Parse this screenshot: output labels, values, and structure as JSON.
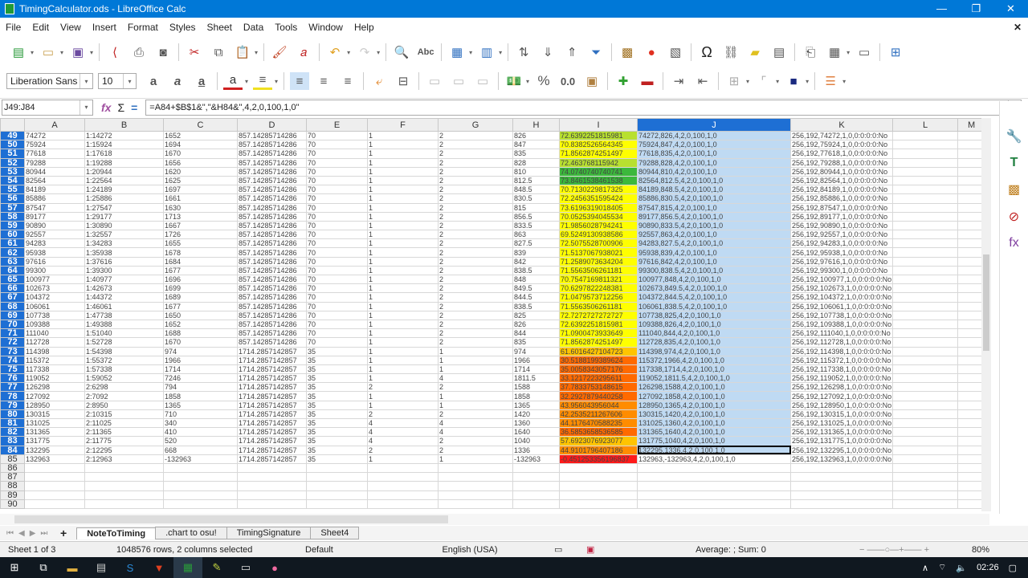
{
  "window": {
    "title": "TimingCalculator.ods - LibreOffice Calc",
    "minimize": "—",
    "maximize": "❐",
    "close": "✕"
  },
  "menu": [
    "File",
    "Edit",
    "View",
    "Insert",
    "Format",
    "Styles",
    "Sheet",
    "Data",
    "Tools",
    "Window",
    "Help"
  ],
  "menu_close": "✕",
  "toolbar": {
    "font_name": "Liberation Sans",
    "font_size": "10"
  },
  "formula": {
    "name_box": "J49:J84",
    "content": "=A84+$B$1&\",\"&H84&\",4,2,0,100,1,0\""
  },
  "columns": [
    "A",
    "B",
    "C",
    "D",
    "E",
    "F",
    "G",
    "H",
    "I",
    "J",
    "K",
    "L",
    "M"
  ],
  "colors": {
    "selection": "#1e6fd4",
    "yellow": "#ffff00",
    "light_green": "#b8e030",
    "green": "#3cb83c",
    "orange": "#ff8c00",
    "dark_orange": "#ff6a00",
    "red": "#ff1a1a",
    "amber": "#ffc400"
  },
  "rows": [
    {
      "n": "49",
      "A": "74272",
      "B": "1:14272",
      "C": "1652",
      "D": "857.14285714286",
      "E": "70",
      "F": "1",
      "G": "2",
      "H": "826",
      "I": "72.6392251815981",
      "J": "74272,826,4,2,0,100,1,0",
      "K": "256,192,74272,1,0,0:0:0:0:No",
      "c": "light_green"
    },
    {
      "n": "50",
      "A": "75924",
      "B": "1:15924",
      "C": "1694",
      "D": "857.14285714286",
      "E": "70",
      "F": "1",
      "G": "2",
      "H": "847",
      "I": "70.8382526564345",
      "J": "75924,847,4,2,0,100,1,0",
      "K": "256,192,75924,1,0,0:0:0:0:No",
      "c": "yellow"
    },
    {
      "n": "51",
      "A": "77618",
      "B": "1:17618",
      "C": "1670",
      "D": "857.14285714286",
      "E": "70",
      "F": "1",
      "G": "2",
      "H": "835",
      "I": "71.8562874251497",
      "J": "77618,835,4,2,0,100,1,0",
      "K": "256,192,77618,1,0,0:0:0:0:No",
      "c": "yellow"
    },
    {
      "n": "52",
      "A": "79288",
      "B": "1:19288",
      "C": "1656",
      "D": "857.14285714286",
      "E": "70",
      "F": "1",
      "G": "2",
      "H": "828",
      "I": "72.463768115942",
      "J": "79288,828,4,2,0,100,1,0",
      "K": "256,192,79288,1,0,0:0:0:0:No",
      "c": "light_green"
    },
    {
      "n": "53",
      "A": "80944",
      "B": "1:20944",
      "C": "1620",
      "D": "857.14285714286",
      "E": "70",
      "F": "1",
      "G": "2",
      "H": "810",
      "I": "74.0740740740741",
      "J": "80944,810,4,2,0,100,1,0",
      "K": "256,192,80944,1,0,0:0:0:0:No",
      "c": "green"
    },
    {
      "n": "54",
      "A": "82564",
      "B": "1:22564",
      "C": "1625",
      "D": "857.14285714286",
      "E": "70",
      "F": "1",
      "G": "2",
      "H": "812.5",
      "I": "73.8461538461538",
      "J": "82564,812.5,4,2,0,100,1,0",
      "K": "256,192,82564,1,0,0:0:0:0:No",
      "c": "green"
    },
    {
      "n": "55",
      "A": "84189",
      "B": "1:24189",
      "C": "1697",
      "D": "857.14285714286",
      "E": "70",
      "F": "1",
      "G": "2",
      "H": "848.5",
      "I": "70.7130229817325",
      "J": "84189,848.5,4,2,0,100,1,0",
      "K": "256,192,84189,1,0,0:0:0:0:No",
      "c": "yellow"
    },
    {
      "n": "56",
      "A": "85886",
      "B": "1:25886",
      "C": "1661",
      "D": "857.14285714286",
      "E": "70",
      "F": "1",
      "G": "2",
      "H": "830.5",
      "I": "72.2456351595424",
      "J": "85886,830.5,4,2,0,100,1,0",
      "K": "256,192,85886,1,0,0:0:0:0:No",
      "c": "yellow"
    },
    {
      "n": "57",
      "A": "87547",
      "B": "1:27547",
      "C": "1630",
      "D": "857.14285714286",
      "E": "70",
      "F": "1",
      "G": "2",
      "H": "815",
      "I": "73.6196319018405",
      "J": "87547,815,4,2,0,100,1,0",
      "K": "256,192,87547,1,0,0:0:0:0:No",
      "c": "yellow"
    },
    {
      "n": "58",
      "A": "89177",
      "B": "1:29177",
      "C": "1713",
      "D": "857.14285714286",
      "E": "70",
      "F": "1",
      "G": "2",
      "H": "856.5",
      "I": "70.0525394045534",
      "J": "89177,856.5,4,2,0,100,1,0",
      "K": "256,192,89177,1,0,0:0:0:0:No",
      "c": "yellow"
    },
    {
      "n": "59",
      "A": "90890",
      "B": "1:30890",
      "C": "1667",
      "D": "857.14285714286",
      "E": "70",
      "F": "1",
      "G": "2",
      "H": "833.5",
      "I": "71.9856028794241",
      "J": "90890,833.5,4,2,0,100,1,0",
      "K": "256,192,90890,1,0,0:0:0:0:No",
      "c": "yellow"
    },
    {
      "n": "60",
      "A": "92557",
      "B": "1:32557",
      "C": "1726",
      "D": "857.14285714286",
      "E": "70",
      "F": "1",
      "G": "2",
      "H": "863",
      "I": "69.5249130938586",
      "J": "92557,863,4,2,0,100,1,0",
      "K": "256,192,92557,1,0,0:0:0:0:No",
      "c": "yellow"
    },
    {
      "n": "61",
      "A": "94283",
      "B": "1:34283",
      "C": "1655",
      "D": "857.14285714286",
      "E": "70",
      "F": "1",
      "G": "2",
      "H": "827.5",
      "I": "72.5075528700906",
      "J": "94283,827.5,4,2,0,100,1,0",
      "K": "256,192,94283,1,0,0:0:0:0:No",
      "c": "yellow"
    },
    {
      "n": "62",
      "A": "95938",
      "B": "1:35938",
      "C": "1678",
      "D": "857.14285714286",
      "E": "70",
      "F": "1",
      "G": "2",
      "H": "839",
      "I": "71.5137067938021",
      "J": "95938,839,4,2,0,100,1,0",
      "K": "256,192,95938,1,0,0:0:0:0:No",
      "c": "yellow"
    },
    {
      "n": "63",
      "A": "97616",
      "B": "1:37616",
      "C": "1684",
      "D": "857.14285714286",
      "E": "70",
      "F": "1",
      "G": "2",
      "H": "842",
      "I": "71.2589073634204",
      "J": "97616,842,4,2,0,100,1,0",
      "K": "256,192,97616,1,0,0:0:0:0:No",
      "c": "yellow"
    },
    {
      "n": "64",
      "A": "99300",
      "B": "1:39300",
      "C": "1677",
      "D": "857.14285714286",
      "E": "70",
      "F": "1",
      "G": "2",
      "H": "838.5",
      "I": "71.5563506261181",
      "J": "99300,838.5,4,2,0,100,1,0",
      "K": "256,192,99300,1,0,0:0:0:0:No",
      "c": "yellow"
    },
    {
      "n": "65",
      "A": "100977",
      "B": "1:40977",
      "C": "1696",
      "D": "857.14285714286",
      "E": "70",
      "F": "1",
      "G": "2",
      "H": "848",
      "I": "70.7547169811321",
      "J": "100977,848,4,2,0,100,1,0",
      "K": "256,192,100977,1,0,0:0:0:0:No",
      "c": "yellow"
    },
    {
      "n": "66",
      "A": "102673",
      "B": "1:42673",
      "C": "1699",
      "D": "857.14285714286",
      "E": "70",
      "F": "1",
      "G": "2",
      "H": "849.5",
      "I": "70.6297822248381",
      "J": "102673,849.5,4,2,0,100,1,0",
      "K": "256,192,102673,1,0,0:0:0:0:No",
      "c": "yellow"
    },
    {
      "n": "67",
      "A": "104372",
      "B": "1:44372",
      "C": "1689",
      "D": "857.14285714286",
      "E": "70",
      "F": "1",
      "G": "2",
      "H": "844.5",
      "I": "71.0479573712256",
      "J": "104372,844.5,4,2,0,100,1,0",
      "K": "256,192,104372,1,0,0:0:0:0:No",
      "c": "yellow"
    },
    {
      "n": "68",
      "A": "106061",
      "B": "1:46061",
      "C": "1677",
      "D": "857.14285714286",
      "E": "70",
      "F": "1",
      "G": "2",
      "H": "838.5",
      "I": "71.5563506261181",
      "J": "106061,838.5,4,2,0,100,1,0",
      "K": "256,192,106061,1,0,0:0:0:0:No",
      "c": "yellow"
    },
    {
      "n": "69",
      "A": "107738",
      "B": "1:47738",
      "C": "1650",
      "D": "857.14285714286",
      "E": "70",
      "F": "1",
      "G": "2",
      "H": "825",
      "I": "72.7272727272727",
      "J": "107738,825,4,2,0,100,1,0",
      "K": "256,192,107738,1,0,0:0:0:0:No",
      "c": "yellow"
    },
    {
      "n": "70",
      "A": "109388",
      "B": "1:49388",
      "C": "1652",
      "D": "857.14285714286",
      "E": "70",
      "F": "1",
      "G": "2",
      "H": "826",
      "I": "72.6392251815981",
      "J": "109388,826,4,2,0,100,1,0",
      "K": "256,192,109388,1,0,0:0:0:0:No",
      "c": "yellow"
    },
    {
      "n": "71",
      "A": "111040",
      "B": "1:51040",
      "C": "1688",
      "D": "857.14285714286",
      "E": "70",
      "F": "1",
      "G": "2",
      "H": "844",
      "I": "71.0900473933649",
      "J": "111040,844,4,2,0,100,1,0",
      "K": "256,192,111040,1,0,0:0:0:0:No",
      "c": "yellow"
    },
    {
      "n": "72",
      "A": "112728",
      "B": "1:52728",
      "C": "1670",
      "D": "857.14285714286",
      "E": "70",
      "F": "1",
      "G": "2",
      "H": "835",
      "I": "71.8562874251497",
      "J": "112728,835,4,2,0,100,1,0",
      "K": "256,192,112728,1,0,0:0:0:0:No",
      "c": "yellow"
    },
    {
      "n": "73",
      "A": "114398",
      "B": "1:54398",
      "C": "974",
      "D": "1714.2857142857",
      "E": "35",
      "F": "1",
      "G": "1",
      "H": "974",
      "I": "61.6016427104723",
      "J": "114398,974,4,2,0,100,1,0",
      "K": "256,192,114398,1,0,0:0:0:0:No",
      "c": "amber"
    },
    {
      "n": "74",
      "A": "115372",
      "B": "1:55372",
      "C": "1966",
      "D": "1714.2857142857",
      "E": "35",
      "F": "1",
      "G": "1",
      "H": "1966",
      "I": "30.5188199389624",
      "J": "115372,1966,4,2,0,100,1,0",
      "K": "256,192,115372,1,0,0:0:0:0:No",
      "c": "dark_orange"
    },
    {
      "n": "75",
      "A": "117338",
      "B": "1:57338",
      "C": "1714",
      "D": "1714.2857142857",
      "E": "35",
      "F": "1",
      "G": "1",
      "H": "1714",
      "I": "35.0058343057176",
      "J": "117338,1714,4,2,0,100,1,0",
      "K": "256,192,117338,1,0,0:0:0:0:No",
      "c": "dark_orange"
    },
    {
      "n": "76",
      "A": "119052",
      "B": "1:59052",
      "C": "7246",
      "D": "1714.2857142857",
      "E": "35",
      "F": "1",
      "G": "4",
      "H": "1811.5",
      "I": "33.1217223295611",
      "J": "119052,1811.5,4,2,0,100,1,0",
      "K": "256,192,119052,1,0,0:0:0:0:No",
      "c": "dark_orange"
    },
    {
      "n": "77",
      "A": "126298",
      "B": "2:6298",
      "C": "794",
      "D": "1714.2857142857",
      "E": "35",
      "F": "2",
      "G": "2",
      "H": "1588",
      "I": "37.7833753148615",
      "J": "126298,1588,4,2,0,100,1,0",
      "K": "256,192,126298,1,0,0:0:0:0:No",
      "c": "dark_orange"
    },
    {
      "n": "78",
      "A": "127092",
      "B": "2:7092",
      "C": "1858",
      "D": "1714.2857142857",
      "E": "35",
      "F": "1",
      "G": "1",
      "H": "1858",
      "I": "32.2927879440258",
      "J": "127092,1858,4,2,0,100,1,0",
      "K": "256,192,127092,1,0,0:0:0:0:No",
      "c": "dark_orange"
    },
    {
      "n": "79",
      "A": "128950",
      "B": "2:8950",
      "C": "1365",
      "D": "1714.2857142857",
      "E": "35",
      "F": "1",
      "G": "1",
      "H": "1365",
      "I": "43.956043956044",
      "J": "128950,1365,4,2,0,100,1,0",
      "K": "256,192,128950,1,0,0:0:0:0:No",
      "c": "orange"
    },
    {
      "n": "80",
      "A": "130315",
      "B": "2:10315",
      "C": "710",
      "D": "1714.2857142857",
      "E": "35",
      "F": "2",
      "G": "2",
      "H": "1420",
      "I": "42.2535211267606",
      "J": "130315,1420,4,2,0,100,1,0",
      "K": "256,192,130315,1,0,0:0:0:0:No",
      "c": "orange"
    },
    {
      "n": "81",
      "A": "131025",
      "B": "2:11025",
      "C": "340",
      "D": "1714.2857142857",
      "E": "35",
      "F": "4",
      "G": "4",
      "H": "1360",
      "I": "44.1176470588235",
      "J": "131025,1360,4,2,0,100,1,0",
      "K": "256,192,131025,1,0,0:0:0:0:No",
      "c": "orange"
    },
    {
      "n": "82",
      "A": "131365",
      "B": "2:11365",
      "C": "410",
      "D": "1714.2857142857",
      "E": "35",
      "F": "4",
      "G": "4",
      "H": "1640",
      "I": "36.5853658536585",
      "J": "131365,1640,4,2,0,100,1,0",
      "K": "256,192,131365,1,0,0:0:0:0:No",
      "c": "dark_orange"
    },
    {
      "n": "83",
      "A": "131775",
      "B": "2:11775",
      "C": "520",
      "D": "1714.2857142857",
      "E": "35",
      "F": "4",
      "G": "2",
      "H": "1040",
      "I": "57.6923076923077",
      "J": "131775,1040,4,2,0,100,1,0",
      "K": "256,192,131775,1,0,0:0:0:0:No",
      "c": "amber"
    },
    {
      "n": "84",
      "A": "132295",
      "B": "2:12295",
      "C": "668",
      "D": "1714.2857142857",
      "E": "35",
      "F": "2",
      "G": "2",
      "H": "1336",
      "I": "44.9101796407186",
      "J": "132295,1336,4,2,0,100,1,0",
      "K": "256,192,132295,1,0,0:0:0:0:No",
      "c": "orange"
    },
    {
      "n": "85",
      "A": "132963",
      "B": "2:12963",
      "C": "-132963",
      "D": "1714.2857142857",
      "E": "35",
      "F": "1",
      "G": "1",
      "H": "-132963",
      "I": "-0.451253356196837",
      "J": "132963,-132963,4,2,0,100,1,0",
      "K": "256,192,132963,1,0,0:0:0:0:No",
      "c": "red"
    },
    {
      "n": "86"
    },
    {
      "n": "87"
    },
    {
      "n": "88"
    },
    {
      "n": "89"
    },
    {
      "n": "90"
    }
  ],
  "sheet_tabs": [
    "NoteToTiming",
    ".chart to osu!",
    "TimingSignature",
    "Sheet4"
  ],
  "active_tab": "NoteToTiming",
  "status": {
    "sheet": "Sheet 1 of 3",
    "selection": "1048576 rows, 2 columns selected",
    "style": "Default",
    "language": "English (USA)",
    "sum": "Average: ; Sum: 0",
    "zoom": "80%"
  },
  "taskbar": {
    "time": "02:26"
  }
}
